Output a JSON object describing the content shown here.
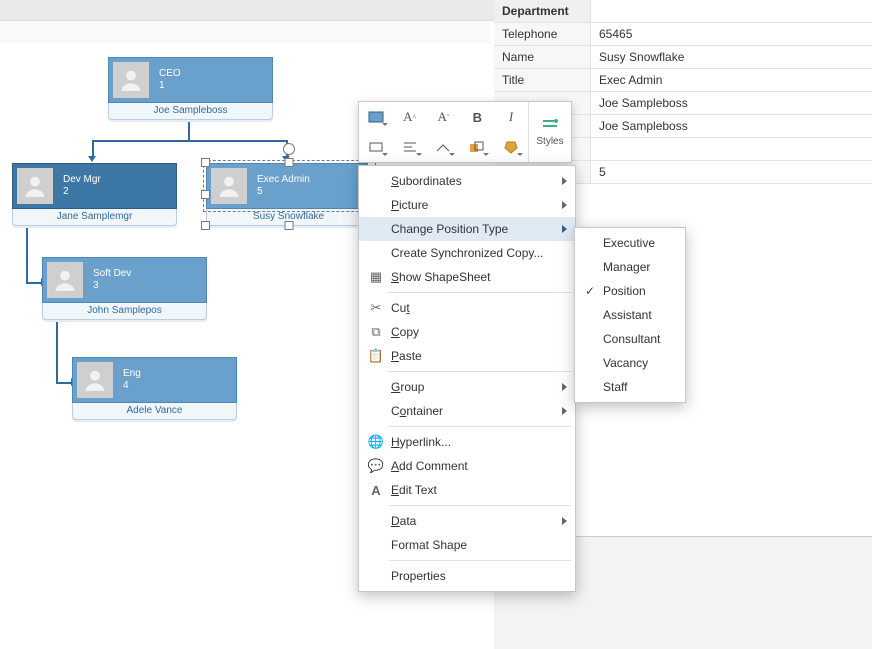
{
  "nodes": {
    "n1": {
      "title": "CEO",
      "num": "1",
      "name": "Joe Sampleboss"
    },
    "n2": {
      "title": "Dev Mgr",
      "num": "2",
      "name": "Jane Samplemgr"
    },
    "n3": {
      "title": "Exec Admin",
      "num": "5",
      "name": "Susy Snowflake"
    },
    "n4": {
      "title": "Soft Dev",
      "num": "3",
      "name": "John Samplepos"
    },
    "n5": {
      "title": "Eng",
      "num": "4",
      "name": "Adele Vance"
    }
  },
  "panel": {
    "rows": [
      {
        "k": "Department",
        "v": ""
      },
      {
        "k": "Telephone",
        "v": "65465"
      },
      {
        "k": "Name",
        "v": "Susy Snowflake"
      },
      {
        "k": "Title",
        "v": "Exec Admin"
      },
      {
        "k": "",
        "v": "Joe Sampleboss"
      },
      {
        "k": "",
        "v": "Joe Sampleboss"
      },
      {
        "k": "",
        "v": ""
      },
      {
        "k": "",
        "v": "5"
      }
    ]
  },
  "mini": {
    "styles": "Styles"
  },
  "menu": {
    "items": {
      "subordinates": "Subordinates",
      "picture": "Picture",
      "change_pos": "Change Position Type",
      "sync_copy": "Create Synchronized Copy...",
      "show_ss": "Show ShapeSheet",
      "cut": "Cut",
      "copy": "Copy",
      "paste": "Paste",
      "group": "Group",
      "container": "Container",
      "hyperlink": "Hyperlink...",
      "add_comment": "Add Comment",
      "edit_text": "Edit Text",
      "data": "Data",
      "format_shape": "Format Shape",
      "properties": "Properties"
    }
  },
  "submenu": {
    "items": {
      "executive": "Executive",
      "manager": "Manager",
      "position": "Position",
      "assistant": "Assistant",
      "consultant": "Consultant",
      "vacancy": "Vacancy",
      "staff": "Staff"
    }
  }
}
